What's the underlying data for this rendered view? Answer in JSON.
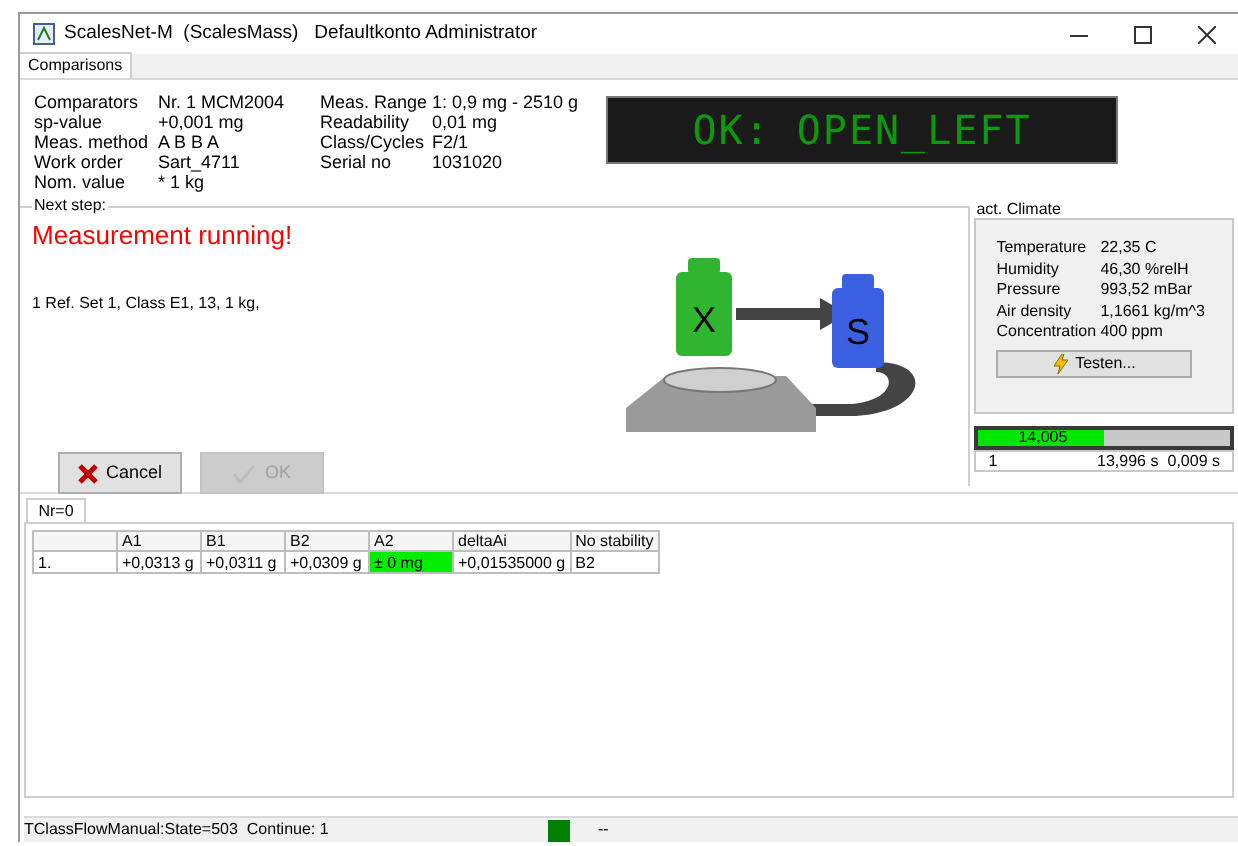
{
  "window": {
    "title": "ScalesNet-M  (ScalesMass)   Defaultkonto Administrator"
  },
  "tabs": [
    {
      "label": "Comparisons",
      "selected": true
    }
  ],
  "info_left": [
    {
      "label": "Comparators",
      "value": "Nr. 1  MCM2004"
    },
    {
      "label": "sp-value",
      "value": "+0,001 mg"
    },
    {
      "label": "Meas. method",
      "value": "A B B A"
    },
    {
      "label": "Work order",
      "value": "Sart_4711"
    },
    {
      "label": "Nom. value",
      "value": "* 1 kg"
    }
  ],
  "info_right": [
    {
      "label": "Meas. Range",
      "value": "1: 0,9 mg - 2510 g"
    },
    {
      "label": "Readability",
      "value": "0,01 mg"
    },
    {
      "label": "Class/Cycles",
      "value": "F2/1"
    },
    {
      "label": "Serial no",
      "value": "1031020"
    }
  ],
  "display": {
    "text": "OK: OPEN_LEFT"
  },
  "next_step": {
    "legend": "Next step:",
    "heading": "Measurement running!",
    "description": "1  Ref. Set 1, Class E1, 13, 1 kg,"
  },
  "weights": [
    {
      "label": "X",
      "color": "#2fb52f"
    },
    {
      "label": "S",
      "color": "#3a5fe0"
    }
  ],
  "buttons": [
    {
      "kind": "cancel",
      "label": "Cancel",
      "disabled": false
    },
    {
      "kind": "ok",
      "label": "OK",
      "disabled": true
    }
  ],
  "climate": {
    "legend": "act. Climate",
    "rows": [
      {
        "label": "Temperature",
        "value": "22,35 C"
      },
      {
        "label": "Humidity",
        "value": "46,30 %relH"
      },
      {
        "label": "Pressure",
        "value": "993,52 mBar"
      },
      {
        "label": "Air density",
        "value": "1,1661 kg/m^3"
      },
      {
        "label": "Concentration",
        "value": "400 ppm"
      }
    ],
    "test_button": "Testen..."
  },
  "progress": {
    "level": 0.5,
    "label": "14,005"
  },
  "timing": [
    "1",
    "13,996 s",
    "0,009 s"
  ],
  "lower_tabs": [
    {
      "label": "Nr=0",
      "selected": true
    }
  ],
  "table": {
    "columns": [
      "",
      "A1",
      "B1",
      "B2",
      "A2",
      "deltaAi",
      "No stability"
    ],
    "rows": [
      {
        "cells": [
          {
            "text": "1.",
            "highlighted": false
          },
          {
            "text": "+0,0313 g",
            "highlighted": false
          },
          {
            "text": "+0,0311 g",
            "highlighted": false
          },
          {
            "text": "+0,0309 g",
            "highlighted": false
          },
          {
            "text": "± 0 mg",
            "highlighted": true
          },
          {
            "text": "+0,01535000 g",
            "highlighted": false
          },
          {
            "text": "B2",
            "highlighted": false
          }
        ]
      }
    ]
  },
  "status_bar": {
    "text": "TClassFlowManual:State=503  Continue: 1",
    "indicator_on": true,
    "extra": "--"
  }
}
